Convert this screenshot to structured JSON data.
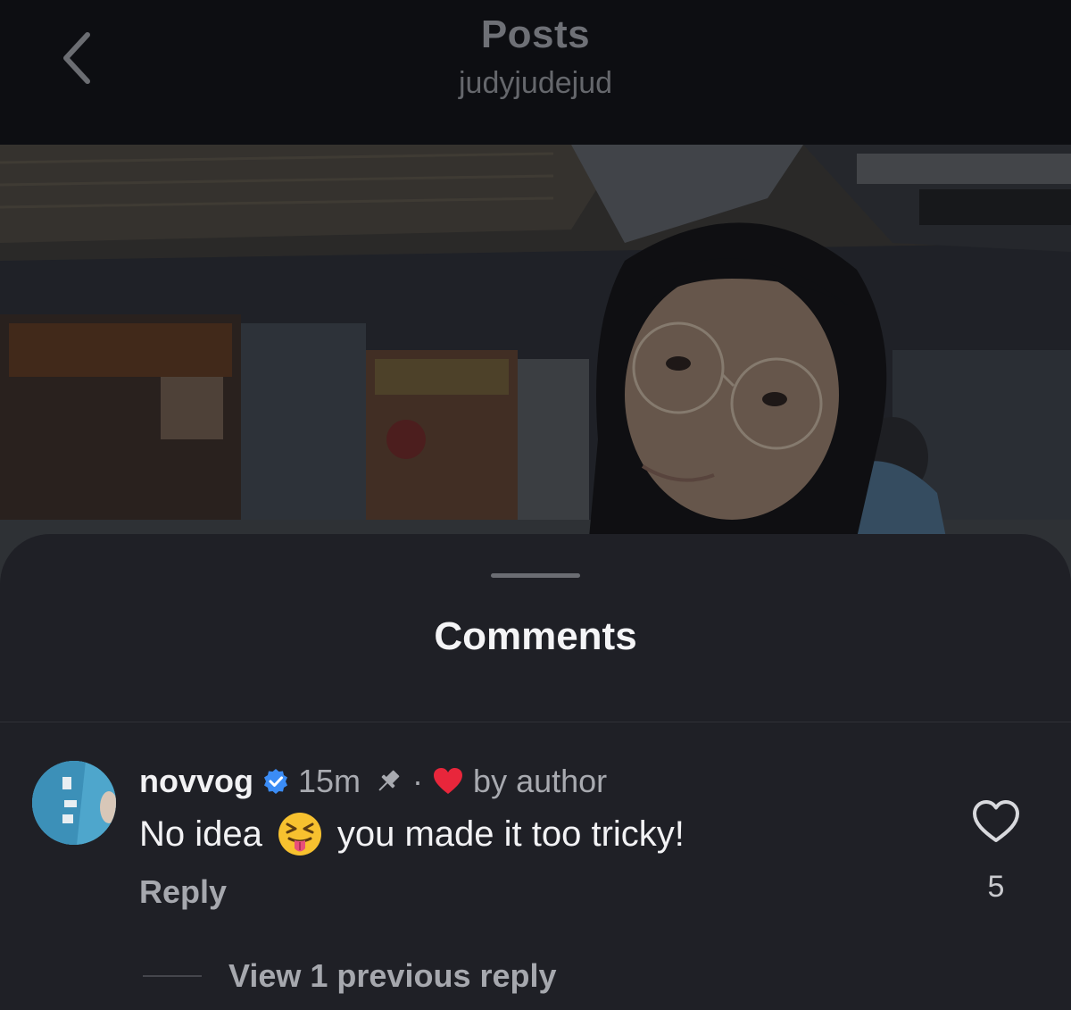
{
  "header": {
    "title": "Posts",
    "subtitle": "judyjudejud"
  },
  "sheet": {
    "title": "Comments"
  },
  "comment": {
    "username": "novvog",
    "time": "15m",
    "separator": "·",
    "liked_by_author_label": "by author",
    "text_before_emoji": "No idea",
    "text_after_emoji": "you made it too tricky!",
    "reply_label": "Reply",
    "like_count": "5"
  },
  "replies": {
    "view_label": "View 1 previous reply"
  },
  "colors": {
    "background": "#1f2026",
    "header": "#0d0e12",
    "heart_red": "#e8263b",
    "verified_blue": "#3b8cf5"
  }
}
